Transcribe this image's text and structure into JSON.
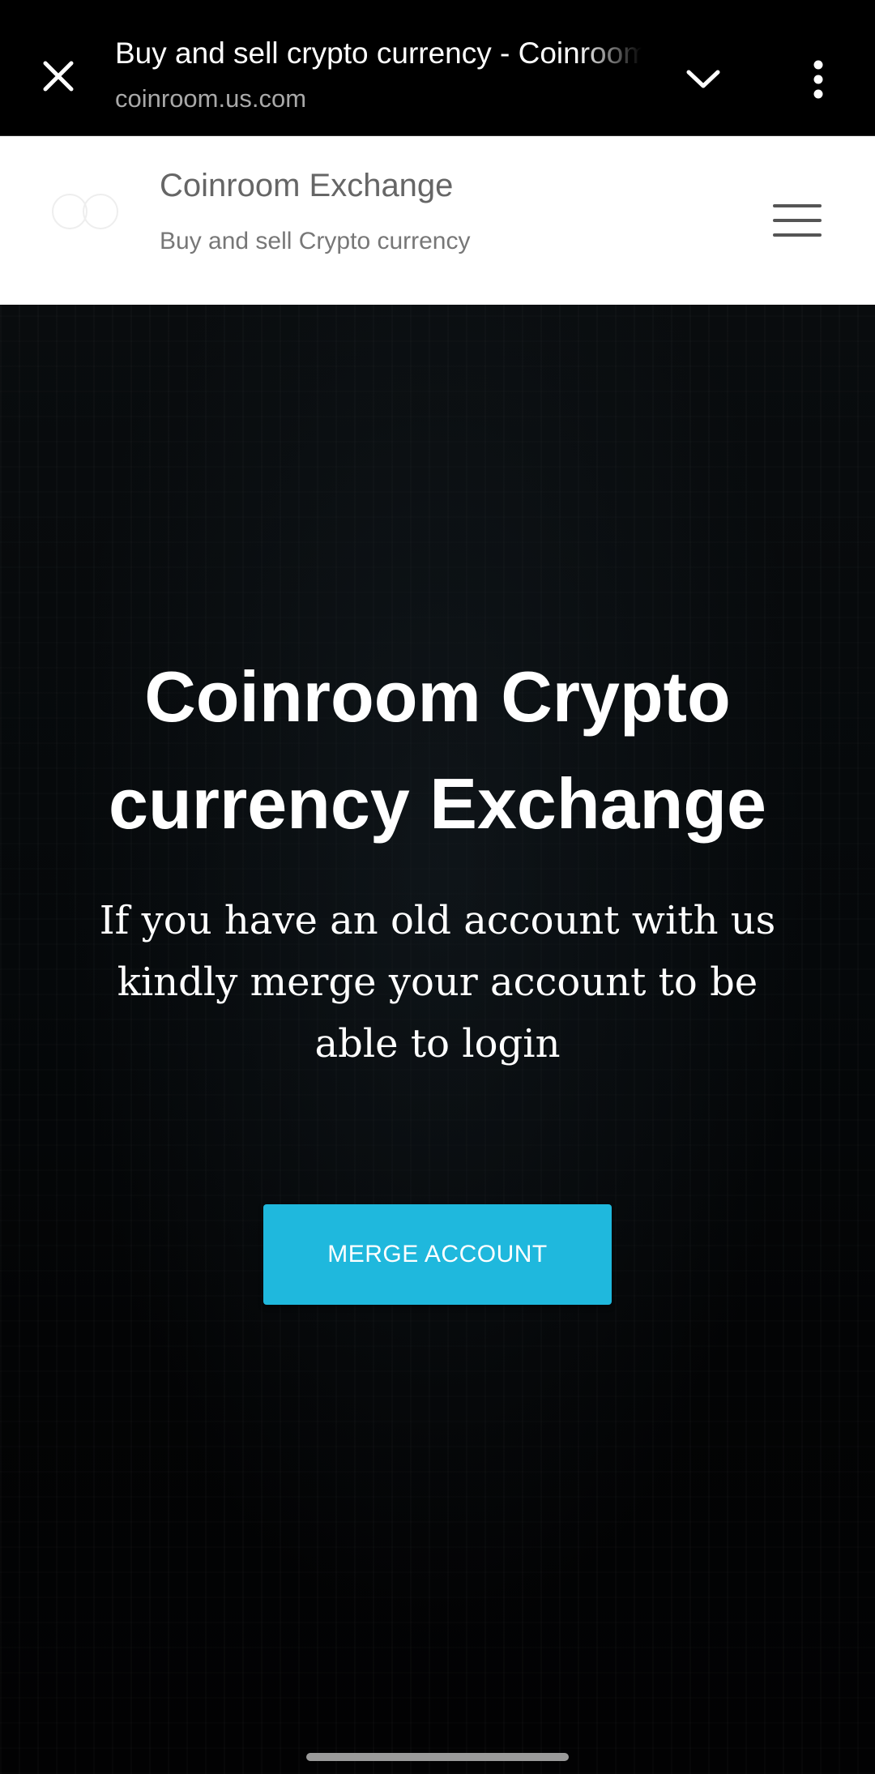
{
  "browser": {
    "tab_title": "Buy and sell crypto currency - Coinroom",
    "url": "coinroom.us.com",
    "icons": {
      "close": "close-icon",
      "expand": "chevron-down-icon",
      "more": "more-vert-icon"
    }
  },
  "site_header": {
    "name": "Coinroom Exchange",
    "tagline": "Buy and sell Crypto currency",
    "logo": "two-circles-logo",
    "menu_icon": "hamburger-menu-icon"
  },
  "hero": {
    "title": "Coinroom Crypto currency Exchange",
    "text": "If you have an old account with us kindly merge your account to be able to login",
    "button_label": "MERGE ACCOUNT"
  },
  "colors": {
    "accent": "#1fb8dd",
    "hero_background": "#05080a",
    "header_background": "#ffffff",
    "toolbar_background": "#000000"
  }
}
